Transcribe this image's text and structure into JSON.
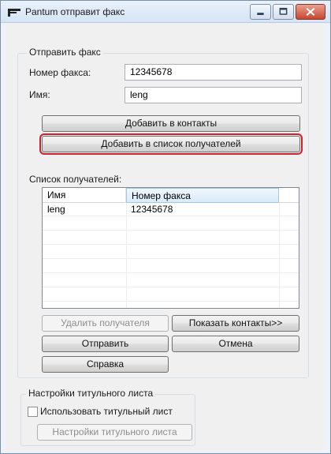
{
  "window": {
    "title": "Pantum отправит факс"
  },
  "send_fax_group": {
    "title": "Отправить факс",
    "fax_number_label": "Номер факса:",
    "fax_number_value": "12345678",
    "name_label": "Имя:",
    "name_value": "leng",
    "add_to_contacts_label": "Добавить в контакты",
    "add_to_recipients_label": "Добавить в список получателей",
    "recipients_label": "Список получателей:",
    "recipients_columns": [
      "Имя",
      "Номер факса"
    ],
    "recipients_rows": [
      {
        "name": "leng",
        "fax": "12345678"
      }
    ],
    "remove_recipient_label": "Удалить получателя",
    "show_contacts_label": "Показать контакты>>",
    "send_label": "Отправить",
    "cancel_label": "Отмена",
    "help_label": "Справка"
  },
  "cover_page_group": {
    "title": "Настройки титульного листа",
    "use_cover_label": "Использовать титульный лист",
    "use_cover_checked": false,
    "cover_settings_label": "Настройки титульного листа"
  },
  "colors": {
    "focus_outline": "#d21f2b",
    "close_button": "#c8462f",
    "header_highlight": "#d9ebfa"
  }
}
